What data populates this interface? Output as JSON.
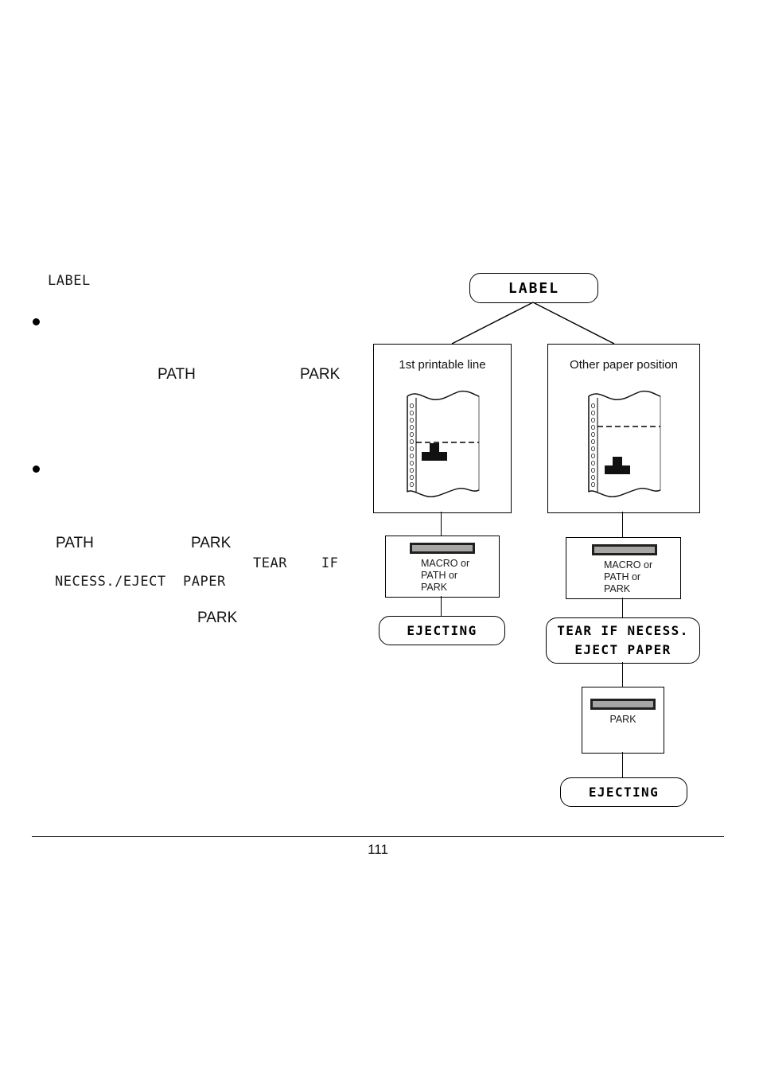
{
  "document": {
    "page_number": "111"
  },
  "body_text": {
    "label_keyword": "LABEL",
    "line_path_1": "PATH",
    "line_park_1": "PARK",
    "line_path_2": "PATH",
    "line_park_2": "PARK",
    "line_tear": "TEAR    IF",
    "line_necess": "NECESS./EJECT  PAPER",
    "line_park_3": "PARK"
  },
  "diagram": {
    "root": {
      "label": "LABEL"
    },
    "branches": [
      {
        "title": "1st printable line",
        "panel": {
          "key_label": "MACRO or\nPATH or\nPARK"
        },
        "result": "EJECTING"
      },
      {
        "title": "Other paper position",
        "panel": {
          "key_label": "MACRO or\nPATH or\nPARK"
        },
        "result": "TEAR IF NECESS.\nEJECT PAPER",
        "result_line1": "TEAR IF NECESS.",
        "result_line2": "EJECT PAPER",
        "panel2": {
          "key_label": "PARK"
        },
        "result2": "EJECTING"
      }
    ],
    "colors": {
      "key_fill": "#a6a6a6",
      "key_border": "#231f1c",
      "stroke": "#000000",
      "paper_edge": "#8a8a8a"
    }
  }
}
